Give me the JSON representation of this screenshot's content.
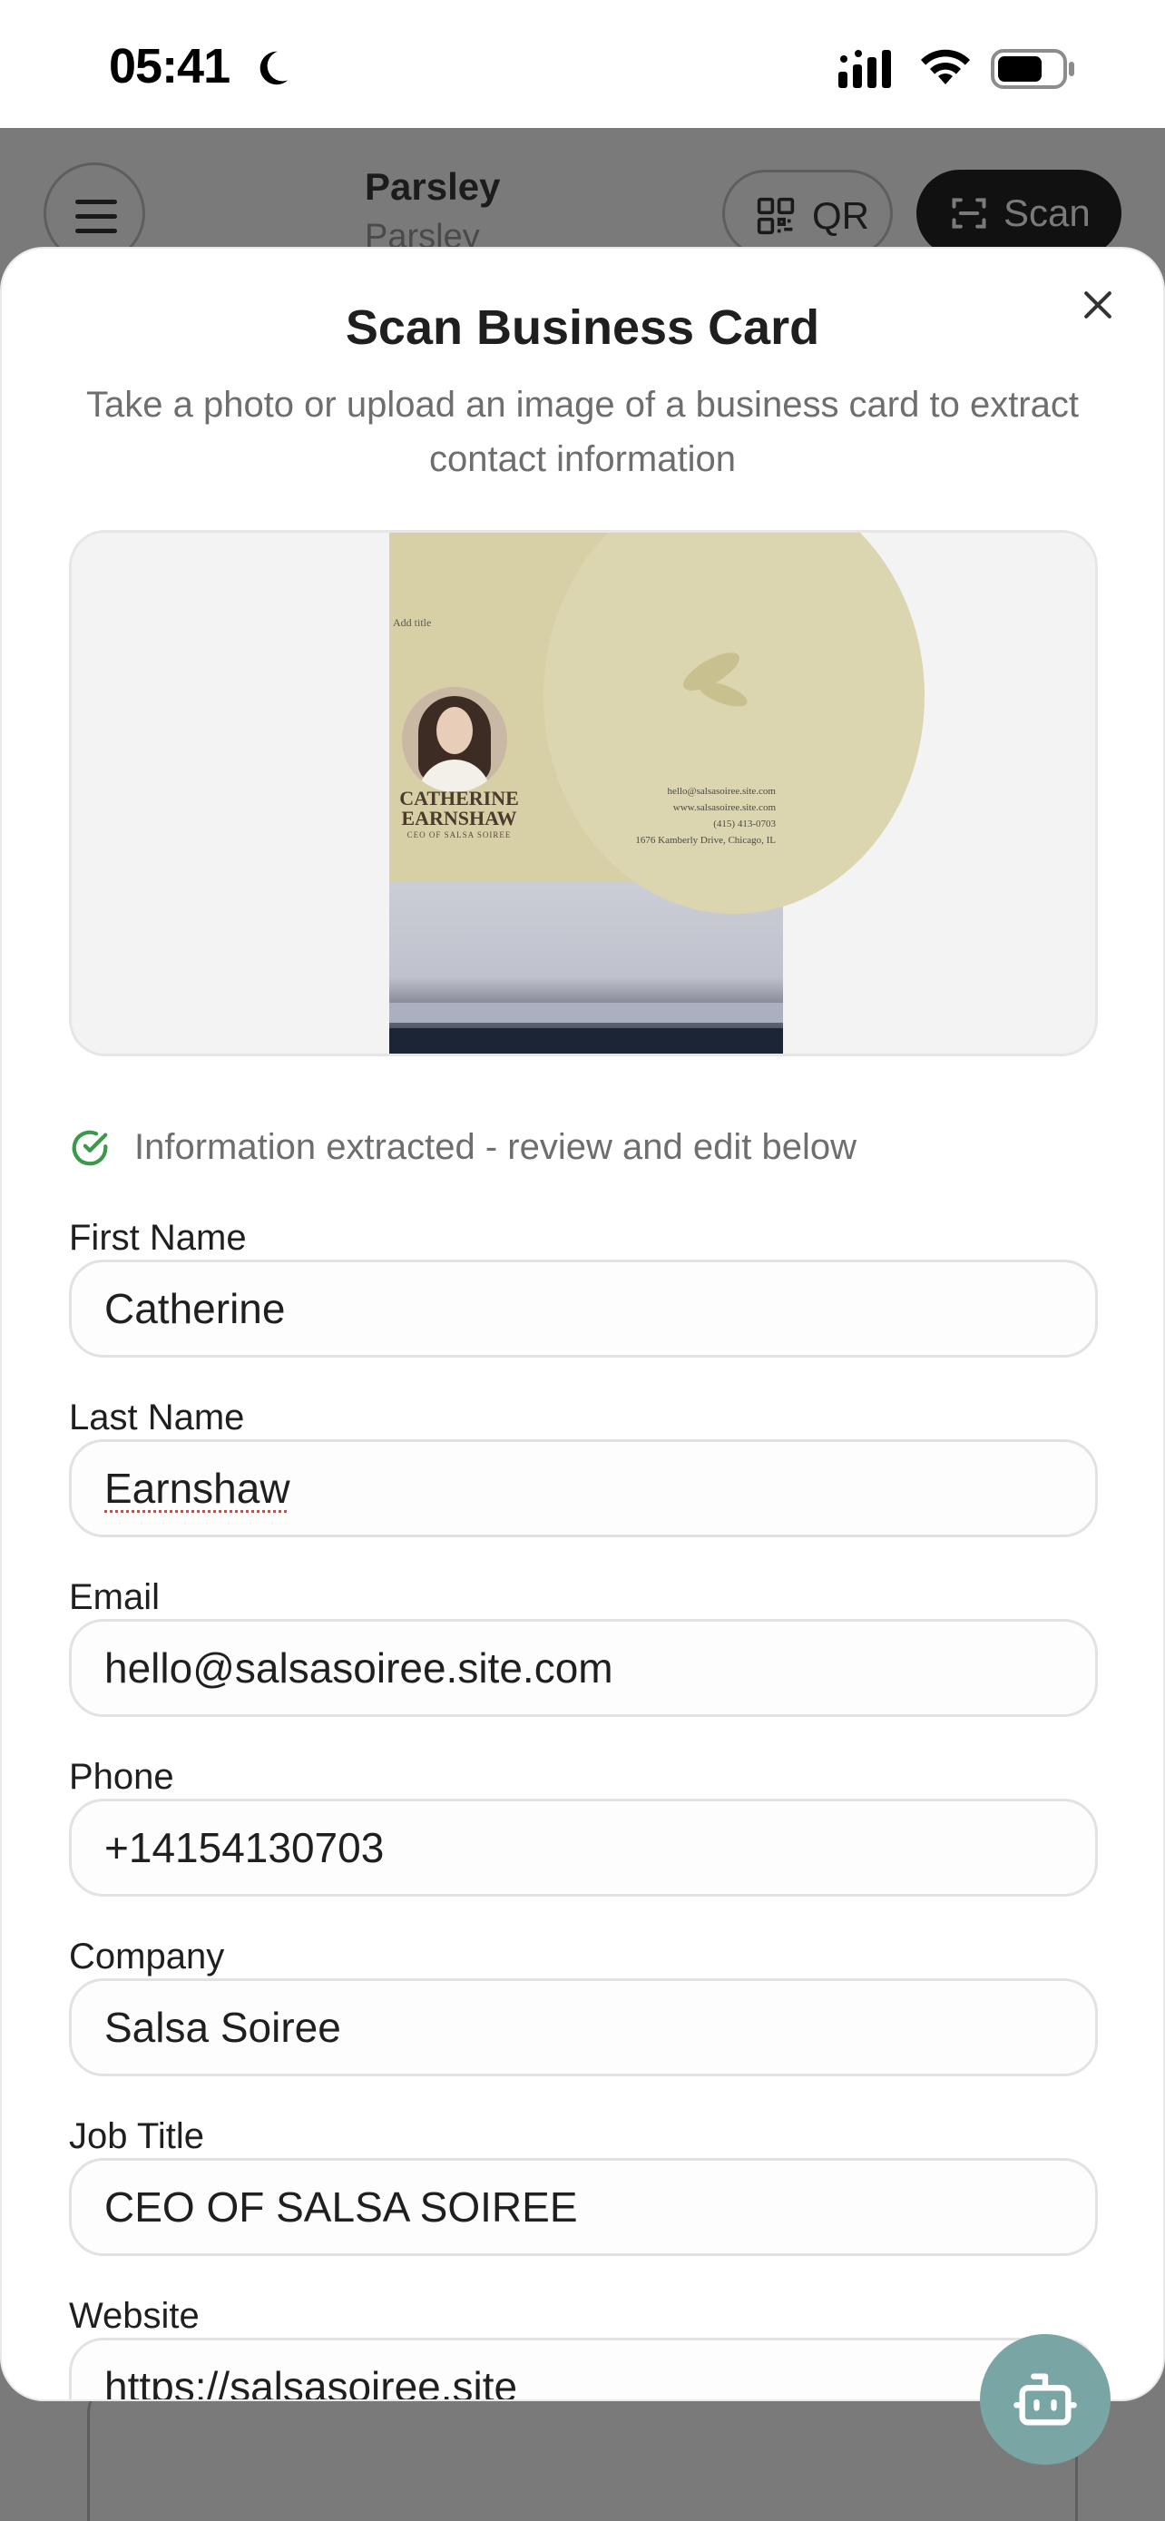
{
  "status_bar": {
    "time": "05:41"
  },
  "app": {
    "title": "Parsley",
    "subtitle": "Parsley",
    "qr_label": "QR",
    "scan_label": "Scan"
  },
  "modal": {
    "title": "Scan Business Card",
    "description": "Take a photo or upload an image of a business card to extract contact information",
    "card_photo": {
      "top_label": "Add title",
      "name": "CATHERINE EARNSHAW",
      "role": "CEO OF SALSA SOIREE",
      "email_line": "hello@salsasoiree.site.com",
      "web_line": "www.salsasoiree.site.com",
      "phone_line": "(415) 413-0703",
      "address_line": "1676 Kamberly Drive, Chicago, IL"
    },
    "extract_status": "Information extracted - review and edit below",
    "fields": {
      "first_name": {
        "label": "First Name",
        "value": "Catherine"
      },
      "last_name": {
        "label": "Last Name",
        "value": "Earnshaw"
      },
      "email": {
        "label": "Email",
        "value": "hello@salsasoiree.site.com"
      },
      "phone": {
        "label": "Phone",
        "value": "+14154130703"
      },
      "company": {
        "label": "Company",
        "value": "Salsa Soiree"
      },
      "job_title": {
        "label": "Job Title",
        "value": "CEO OF SALSA SOIREE"
      },
      "website": {
        "label": "Website",
        "value": "https://salsasoiree.site"
      }
    }
  },
  "icons": {
    "moon": "moon-icon",
    "signal": "cellular-signal-icon",
    "wifi": "wifi-icon",
    "battery": "battery-icon",
    "menu": "hamburger-menu-icon",
    "qr": "qr-code-icon",
    "scan": "scan-frame-icon",
    "close": "close-icon",
    "check": "check-circle-icon",
    "assistant": "robot-icon"
  },
  "colors": {
    "success": "#3a9a4a",
    "fab": "#7aa5a5",
    "scan_button": "#111111"
  }
}
